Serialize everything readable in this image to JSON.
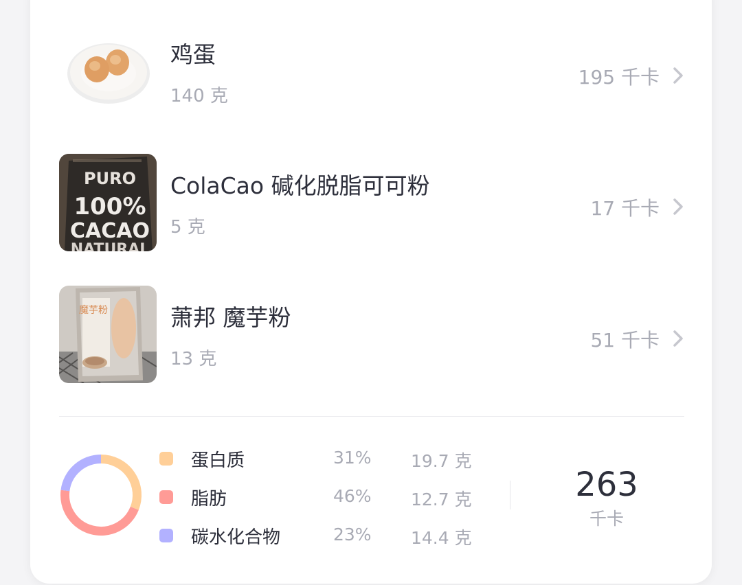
{
  "foods": [
    {
      "name": "鸡蛋",
      "amount": "140 克",
      "kcal": "195 千卡",
      "image": "eggs-on-plate"
    },
    {
      "name": "ColaCao 碱化脱脂可可粉",
      "amount": "5 克",
      "kcal": "17 千卡",
      "image": "cacao-powder-bag",
      "package_text": [
        "PURO",
        "100%",
        "CACAO",
        "NATURAL"
      ]
    },
    {
      "name": "萧邦 魔芋粉",
      "amount": "13 克",
      "kcal": "51 千卡",
      "image": "konjac-powder-bag",
      "package_text": [
        "魔芋粉"
      ]
    }
  ],
  "nutrition": {
    "protein": {
      "label": "蛋白质",
      "percent": "31%",
      "grams": "19.7 克",
      "color": "#ffcf98",
      "fraction": 0.31
    },
    "fat": {
      "label": "脂肪",
      "percent": "46%",
      "grams": "12.7 克",
      "color": "#ff9b96",
      "fraction": 0.46
    },
    "carbs": {
      "label": "碳水化合物",
      "percent": "23%",
      "grams": "14.4 克",
      "color": "#b2b1ff",
      "fraction": 0.23
    }
  },
  "total": {
    "value": "263",
    "unit": "千卡"
  },
  "colors": {
    "text_primary": "#2d2f3b",
    "text_secondary": "#a8aab4",
    "chevron": "#c6c7ce"
  }
}
